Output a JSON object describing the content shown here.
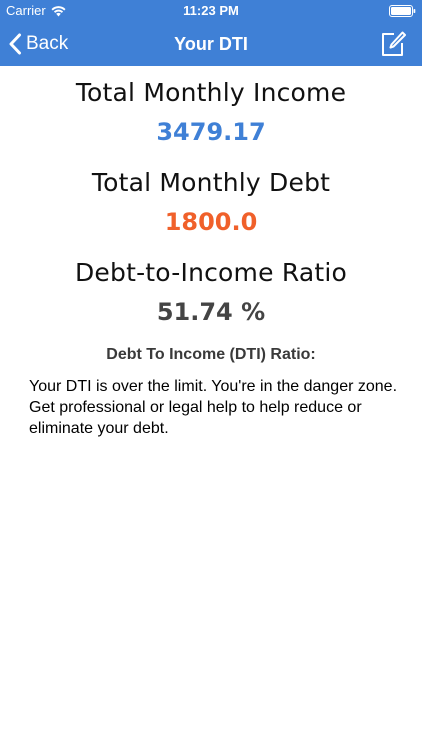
{
  "status_bar": {
    "carrier": "Carrier",
    "time": "11:23 PM"
  },
  "nav": {
    "back_label": "Back",
    "title": "Your DTI",
    "color": "#3f80d6"
  },
  "metrics": {
    "income_label": "Total Monthly Income",
    "income_value": "3479.17",
    "income_color": "#3f80d6",
    "debt_label": "Total Monthly Debt",
    "debt_value": "1800.0",
    "debt_color": "#f0602a",
    "ratio_label": "Debt-to-Income Ratio",
    "ratio_value": "51.74 %"
  },
  "dti": {
    "heading": "Debt To Income (DTI) Ratio:",
    "text": "Your DTI is over the limit. You're in the danger zone.  Get professional or legal help to help reduce or eliminate your debt."
  }
}
